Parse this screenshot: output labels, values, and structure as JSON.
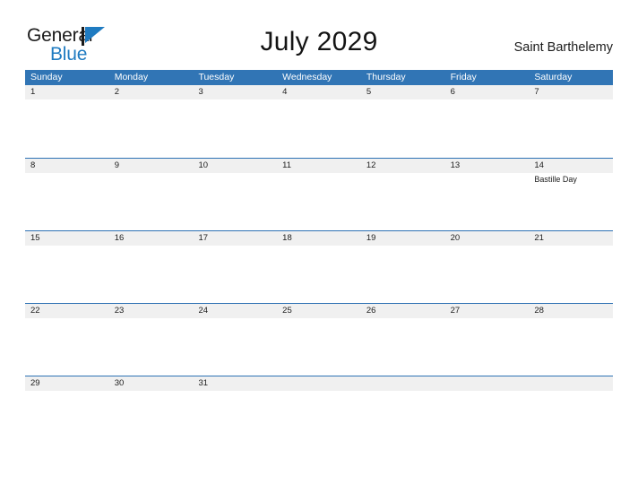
{
  "brand": {
    "word_one": "General",
    "word_two": "Blue",
    "flag_color": "#1f7bc1"
  },
  "header": {
    "title": "July 2029",
    "location": "Saint Barthelemy"
  },
  "theme": {
    "header_blue": "#3175b5",
    "row_divider_blue": "#2e72b4",
    "date_band_gray": "#f0f0f0",
    "text_dark": "#202020",
    "background": "#ffffff"
  },
  "calendar": {
    "day_headers": [
      "Sunday",
      "Monday",
      "Tuesday",
      "Wednesday",
      "Thursday",
      "Friday",
      "Saturday"
    ],
    "weeks": [
      [
        {
          "date": "1",
          "events": []
        },
        {
          "date": "2",
          "events": []
        },
        {
          "date": "3",
          "events": []
        },
        {
          "date": "4",
          "events": []
        },
        {
          "date": "5",
          "events": []
        },
        {
          "date": "6",
          "events": []
        },
        {
          "date": "7",
          "events": []
        }
      ],
      [
        {
          "date": "8",
          "events": []
        },
        {
          "date": "9",
          "events": []
        },
        {
          "date": "10",
          "events": []
        },
        {
          "date": "11",
          "events": []
        },
        {
          "date": "12",
          "events": []
        },
        {
          "date": "13",
          "events": []
        },
        {
          "date": "14",
          "events": [
            "Bastille Day"
          ]
        }
      ],
      [
        {
          "date": "15",
          "events": []
        },
        {
          "date": "16",
          "events": []
        },
        {
          "date": "17",
          "events": []
        },
        {
          "date": "18",
          "events": []
        },
        {
          "date": "19",
          "events": []
        },
        {
          "date": "20",
          "events": []
        },
        {
          "date": "21",
          "events": []
        }
      ],
      [
        {
          "date": "22",
          "events": []
        },
        {
          "date": "23",
          "events": []
        },
        {
          "date": "24",
          "events": []
        },
        {
          "date": "25",
          "events": []
        },
        {
          "date": "26",
          "events": []
        },
        {
          "date": "27",
          "events": []
        },
        {
          "date": "28",
          "events": []
        }
      ],
      [
        {
          "date": "29",
          "events": []
        },
        {
          "date": "30",
          "events": []
        },
        {
          "date": "31",
          "events": []
        },
        {
          "date": "",
          "events": []
        },
        {
          "date": "",
          "events": []
        },
        {
          "date": "",
          "events": []
        },
        {
          "date": "",
          "events": []
        }
      ]
    ]
  }
}
